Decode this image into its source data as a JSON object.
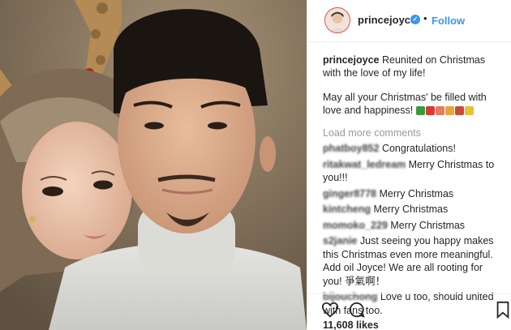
{
  "post": {
    "username": "princejoyce",
    "follow_label": "Follow",
    "separator": "•",
    "verified_glyph": "✓",
    "caption_line1": "Reunited on Christmas with the love of my life!",
    "caption_line2": "May all your Christmas' be filled with love and happiness!",
    "caption_emojis": [
      "christmas-tree",
      "santa",
      "santa-face",
      "gift",
      "candy-cane",
      "bell"
    ],
    "load_more": "Load more comments",
    "likes": "11,608 likes"
  },
  "comments": [
    {
      "user": "phatboy852",
      "text": "Congratulations!"
    },
    {
      "user": "ritakwat_ledream",
      "text": "Merry Christmas to you!!!"
    },
    {
      "user": "ginger8778",
      "text": "Merry Christmas"
    },
    {
      "user": "kintcheng",
      "text": "Merry Christmas"
    },
    {
      "user": "momoko_229",
      "text": "Merry Christmas"
    },
    {
      "user": "s2janie",
      "text": "Just seeing you happy makes this Christmas even more meaningful. Add oil Joyce! We are all rooting for you! 爭氣啊！"
    },
    {
      "user": "bijouchong",
      "text": "Love u too, should united with fans too."
    }
  ],
  "colors": {
    "accent": "#3897f0",
    "text": "#262626",
    "muted": "#999999",
    "avatar_ring": "#e24a3b"
  },
  "icons": {
    "like": "heart-icon",
    "comment": "comment-icon",
    "save": "bookmark-icon",
    "verified": "verified-badge-icon"
  }
}
